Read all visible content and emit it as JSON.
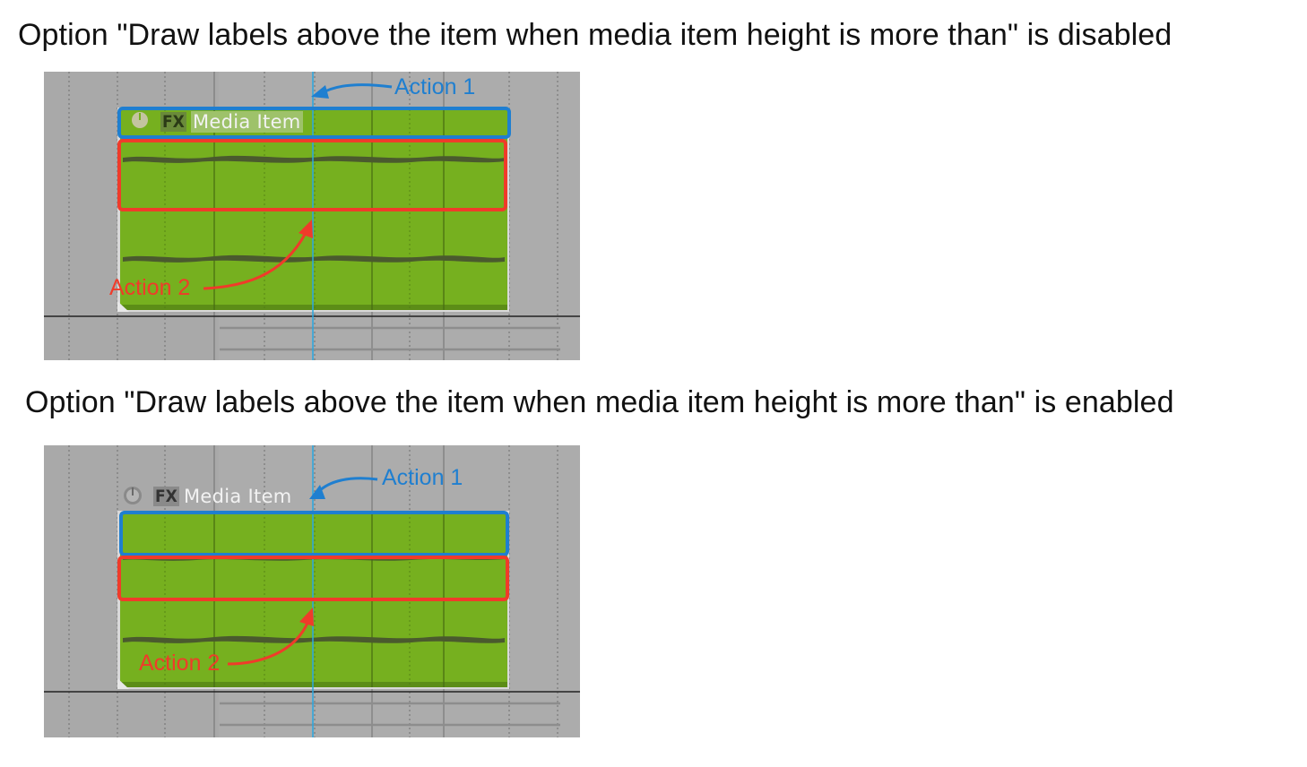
{
  "headings": {
    "disabled": "Option \"Draw labels above the item when media item height is more than\" is disabled",
    "enabled": "Option \"Draw labels above the item when media item height is more than\" is enabled"
  },
  "panel_disabled": {
    "item_label": "Media Item",
    "fx_label": "FX",
    "action1": "Action 1",
    "action2": "Action 2"
  },
  "panel_enabled": {
    "item_label": "Media Item",
    "fx_label": "FX",
    "action1": "Action 1",
    "action2": "Action 2"
  },
  "colors": {
    "item_green": "#76b01f",
    "waveform": "#4a5a2e",
    "track_bg": "#a9a9a9",
    "action1_blue": "#1f7fd0",
    "action2_red": "#f03b2a",
    "cursor": "#2aa7e0"
  },
  "icons": [
    "power-icon",
    "fx-badge-icon"
  ]
}
